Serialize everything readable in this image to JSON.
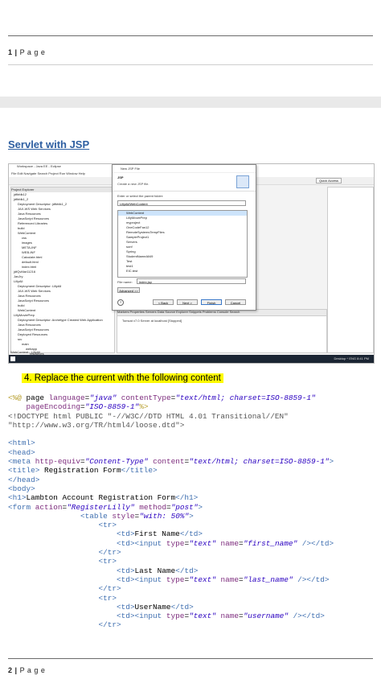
{
  "page1": {
    "number": "1",
    "sep": "|",
    "label": "P a g e"
  },
  "section_title": "Servlet with JSP",
  "eclipse": {
    "title": "Workspace - Java EE - Eclipse",
    "menu": "File  Edit  Navigate  Search  Project  Run  Window  Help",
    "quick_access": "Quick Access",
    "explorer_title": "Project Explorer",
    "explorer_items": [
      "jdfkfdk12",
      "jdfkfdk1_2",
      "Deployment Descriptor: jdfkfdk1_2",
      "JAX-WS Web Services",
      "Java Resources",
      "JavaScript Resources",
      "Referenced Libraries",
      "build",
      "WebContent",
      "css",
      "images",
      "META-INF",
      "WEB-INF",
      "Calculate.html",
      "default.html",
      "index.html",
      "jdfQvMar11216",
      "JavJry",
      "LillyAll",
      "Deployment Descriptor: LillyAll",
      "JAX-WS Web Services",
      "Java Resources",
      "JavaScript Resources",
      "build",
      "WebContent",
      "LillyMoviePrep",
      "Deployment Descriptor: Archetype Created Web Application",
      "Java Resources",
      "JavaScript Resources",
      "Deployed Resources",
      "src",
      "main",
      "webapp",
      "resources"
    ],
    "status": "WebContent - LillyAll",
    "bottom_tabs": "Markers  Properties  Servers  Data Source Explorer  Snippets  Problems  Console  Search",
    "server": "Tomcat v7.0 Server at localhost  [Stopped]",
    "taskbar_right": "Desktop  ^  ENG  8:41 PM"
  },
  "dialog": {
    "title": "New JSP File",
    "heading": "JSP",
    "subheading": "Create a new JSP file.",
    "parent_label": "Enter or select the parent folder:",
    "parent_value": "LillyAll/WebContent",
    "tree": [
      "WebContent",
      "LillyMoviePrep",
      "myproject",
      "OneCodeFan12",
      "RemoteSystemsTempFiles",
      "SampleProject1",
      "Servers",
      "sonf",
      "Spring",
      "StudentNameAll49",
      "Test",
      "test1",
      "EIC.test"
    ],
    "filename_label": "File name:",
    "filename_value": "index.jsp",
    "advanced": "Advanced >>",
    "back": "< Back",
    "next": "Next >",
    "finish": "Finish",
    "cancel": "Cancel"
  },
  "step": "4.  Replace the current with the following content",
  "code_lines": [
    [
      {
        "c": "delim",
        "t": "<%@"
      },
      {
        "c": "",
        "t": " page "
      },
      {
        "c": "attr",
        "t": "language"
      },
      {
        "c": "",
        "t": "="
      },
      {
        "c": "str",
        "t": "\"java\""
      },
      {
        "c": "",
        "t": " "
      },
      {
        "c": "attr",
        "t": "contentType"
      },
      {
        "c": "",
        "t": "="
      },
      {
        "c": "str",
        "t": "\"text/html; charset=ISO-8859-1\""
      }
    ],
    [
      {
        "c": "",
        "t": "    "
      },
      {
        "c": "attr",
        "t": "pageEncoding"
      },
      {
        "c": "",
        "t": "="
      },
      {
        "c": "str",
        "t": "\"ISO-8859-1\""
      },
      {
        "c": "delim",
        "t": "%>"
      }
    ],
    [
      {
        "c": "gray",
        "t": "<!DOCTYPE html PUBLIC \"-//W3C//DTD HTML 4.01 Transitional//EN\""
      }
    ],
    [
      {
        "c": "gray",
        "t": "\"http://www.w3.org/TR/html4/loose.dtd\">"
      }
    ],
    [],
    [
      {
        "c": "tag",
        "t": "<html>"
      }
    ],
    [
      {
        "c": "tag",
        "t": "<head>"
      }
    ],
    [
      {
        "c": "tag",
        "t": "<meta "
      },
      {
        "c": "attr",
        "t": "http-equiv"
      },
      {
        "c": "",
        "t": "="
      },
      {
        "c": "str",
        "t": "\"Content-Type\""
      },
      {
        "c": "",
        "t": " "
      },
      {
        "c": "attr",
        "t": "content"
      },
      {
        "c": "",
        "t": "="
      },
      {
        "c": "str",
        "t": "\"text/html; charset=ISO-8859-1\""
      },
      {
        "c": "tag",
        "t": ">"
      }
    ],
    [
      {
        "c": "tag",
        "t": "<title>"
      },
      {
        "c": "",
        "t": " Registration Form"
      },
      {
        "c": "tag",
        "t": "</title>"
      }
    ],
    [
      {
        "c": "tag",
        "t": "</head>"
      }
    ],
    [
      {
        "c": "tag",
        "t": "<body>"
      }
    ],
    [
      {
        "c": "tag",
        "t": "<h1>"
      },
      {
        "c": "",
        "t": "Lambton Account Registration Form"
      },
      {
        "c": "tag",
        "t": "</h1>"
      }
    ],
    [
      {
        "c": "tag",
        "t": "<form "
      },
      {
        "c": "attr",
        "t": "action"
      },
      {
        "c": "",
        "t": "="
      },
      {
        "c": "str",
        "t": "\"RegisterLilly\""
      },
      {
        "c": "",
        "t": " "
      },
      {
        "c": "attr",
        "t": "method"
      },
      {
        "c": "",
        "t": "="
      },
      {
        "c": "str",
        "t": "\"post\""
      },
      {
        "c": "tag",
        "t": ">"
      }
    ],
    [
      {
        "c": "",
        "t": "                "
      },
      {
        "c": "tag",
        "t": "<table "
      },
      {
        "c": "attr",
        "t": "style"
      },
      {
        "c": "",
        "t": "="
      },
      {
        "c": "str",
        "t": "\"with: 50%\""
      },
      {
        "c": "tag",
        "t": ">"
      }
    ],
    [
      {
        "c": "",
        "t": "                    "
      },
      {
        "c": "tag",
        "t": "<tr>"
      }
    ],
    [
      {
        "c": "",
        "t": "                        "
      },
      {
        "c": "tag",
        "t": "<td>"
      },
      {
        "c": "",
        "t": "First Name"
      },
      {
        "c": "tag",
        "t": "</td>"
      }
    ],
    [
      {
        "c": "",
        "t": "                        "
      },
      {
        "c": "tag",
        "t": "<td><input "
      },
      {
        "c": "attr",
        "t": "type"
      },
      {
        "c": "",
        "t": "="
      },
      {
        "c": "str",
        "t": "\"text\""
      },
      {
        "c": "",
        "t": " "
      },
      {
        "c": "attr",
        "t": "name"
      },
      {
        "c": "",
        "t": "="
      },
      {
        "c": "str",
        "t": "\"first_name\""
      },
      {
        "c": "",
        "t": " "
      },
      {
        "c": "tag",
        "t": "/></td>"
      }
    ],
    [
      {
        "c": "",
        "t": "                    "
      },
      {
        "c": "tag",
        "t": "</tr>"
      }
    ],
    [
      {
        "c": "",
        "t": "                    "
      },
      {
        "c": "tag",
        "t": "<tr>"
      }
    ],
    [
      {
        "c": "",
        "t": "                        "
      },
      {
        "c": "tag",
        "t": "<td>"
      },
      {
        "c": "",
        "t": "Last Name"
      },
      {
        "c": "tag",
        "t": "</td>"
      }
    ],
    [
      {
        "c": "",
        "t": "                        "
      },
      {
        "c": "tag",
        "t": "<td><input "
      },
      {
        "c": "attr",
        "t": "type"
      },
      {
        "c": "",
        "t": "="
      },
      {
        "c": "str",
        "t": "\"text\""
      },
      {
        "c": "",
        "t": " "
      },
      {
        "c": "attr",
        "t": "name"
      },
      {
        "c": "",
        "t": "="
      },
      {
        "c": "str",
        "t": "\"last_name\""
      },
      {
        "c": "",
        "t": " "
      },
      {
        "c": "tag",
        "t": "/></td>"
      }
    ],
    [
      {
        "c": "",
        "t": "                    "
      },
      {
        "c": "tag",
        "t": "</tr>"
      }
    ],
    [
      {
        "c": "",
        "t": "                    "
      },
      {
        "c": "tag",
        "t": "<tr>"
      }
    ],
    [
      {
        "c": "",
        "t": "                        "
      },
      {
        "c": "tag",
        "t": "<td>"
      },
      {
        "c": "",
        "t": "UserName"
      },
      {
        "c": "tag",
        "t": "</td>"
      }
    ],
    [
      {
        "c": "",
        "t": "                        "
      },
      {
        "c": "tag",
        "t": "<td><input "
      },
      {
        "c": "attr",
        "t": "type"
      },
      {
        "c": "",
        "t": "="
      },
      {
        "c": "str",
        "t": "\"text\""
      },
      {
        "c": "",
        "t": " "
      },
      {
        "c": "attr",
        "t": "name"
      },
      {
        "c": "",
        "t": "="
      },
      {
        "c": "str",
        "t": "\"username\""
      },
      {
        "c": "",
        "t": " "
      },
      {
        "c": "tag",
        "t": "/></td>"
      }
    ],
    [
      {
        "c": "",
        "t": "                    "
      },
      {
        "c": "tag",
        "t": "</tr>"
      }
    ]
  ],
  "page2": {
    "number": "2",
    "sep": "|",
    "label": "P a g e"
  }
}
